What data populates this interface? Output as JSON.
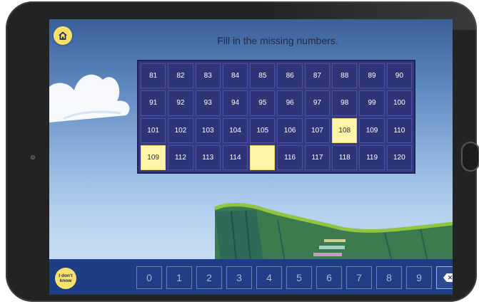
{
  "instruction": "Fill in the missing numbers.",
  "grid": [
    [
      "81",
      "82",
      "83",
      "84",
      "85",
      "86",
      "87",
      "88",
      "89",
      "90"
    ],
    [
      "91",
      "92",
      "93",
      "94",
      "95",
      "96",
      "97",
      "98",
      "99",
      "100"
    ],
    [
      "101",
      "102",
      "103",
      "104",
      "105",
      "106",
      "107",
      "108",
      "109",
      "110"
    ],
    [
      "109",
      "112",
      "113",
      "114",
      "",
      "116",
      "117",
      "118",
      "119",
      "120"
    ]
  ],
  "highlighted_cells": [
    [
      2,
      7
    ],
    [
      3,
      0
    ],
    [
      3,
      4
    ]
  ],
  "idk_label": "I don't know",
  "keypad": [
    "0",
    "1",
    "2",
    "3",
    "4",
    "5",
    "6",
    "7",
    "8",
    "9"
  ],
  "icons": {
    "home": "home-icon",
    "backspace": "backspace-icon"
  },
  "colors": {
    "accent_yellow": "#f7e16a",
    "grid_bg": "#35397f",
    "cell_bg": "#2d3478",
    "highlight": "#fff5a8",
    "bottom_bar": "#1d3d85"
  }
}
